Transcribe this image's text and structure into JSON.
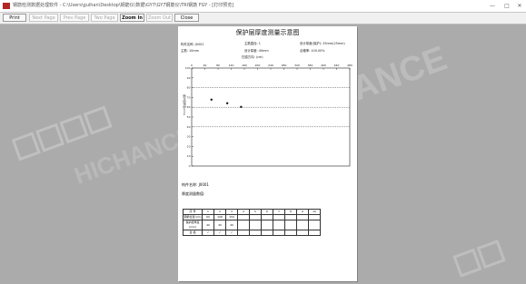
{
  "window": {
    "title": "钢筋检测数据处理软件 - C:\\Users\\guihan\\Desktop\\钢筋仪\\数据\\GY7\\GY7钢筋仪\\TRI钢筋 FGY - [打印预览]",
    "minimize_glyph": "—",
    "maximize_glyph": "□",
    "close_glyph": "✕"
  },
  "toolbar": {
    "print": "Print",
    "next_page": "Next Page",
    "prev_page": "Prev Page",
    "two_page": "Two Page",
    "zoom_in": "Zoom In",
    "zoom_out": "Zoom Out",
    "close": "Close"
  },
  "report": {
    "title": "保护层厚度测量示意图",
    "component_name_label": "构件名称: J0001",
    "stirrup_spacing_label": "主筋直径: 1",
    "design_thickness_label": "设计厚度(保护): 25mm(25mm)",
    "main_rebar_label": "主筋: 10mm",
    "design_value_label": "设计厚度: 40mm",
    "ratio_label": "合格率: 100.00%",
    "scan_direction_label": "扫描方向: (cm)",
    "component_name_bottom": "构件名称: J0001",
    "table_caption": "厚度测量数值:",
    "table_rows": [
      [
        "序 号",
        "1",
        "2",
        "3",
        "4",
        "5",
        "6",
        "7",
        "8",
        "9",
        "10"
      ],
      [
        "钢筋位置(cm)",
        "60",
        "108",
        "150",
        "",
        "",
        "",
        "",
        "",
        "",
        ""
      ],
      [
        "保护层厚度(mm)",
        "40",
        "40",
        "40",
        "",
        "",
        "",
        "",
        "",
        "",
        ""
      ],
      [
        "合 格",
        "√",
        "√",
        "√",
        "",
        "",
        "",
        "",
        "",
        "",
        ""
      ]
    ]
  },
  "chart_data": {
    "type": "scatter",
    "x_tick_labels": [
      "0",
      "40",
      "80",
      "120",
      "160",
      "200",
      "240",
      "280",
      "320",
      "360",
      "400",
      "440",
      "480"
    ],
    "y_tick_labels": [
      "100",
      "90",
      "80",
      "70",
      "60",
      "50",
      "40",
      "30",
      "20",
      "10",
      "0"
    ],
    "y_axis_label": "保护层厚度(mm)",
    "xlim": [
      0,
      480
    ],
    "ylim": [
      0,
      100
    ],
    "y_inverted": true,
    "reference_lines_y": [
      40,
      60,
      80
    ],
    "points": [
      {
        "x": 60,
        "y": 40
      },
      {
        "x": 108,
        "y": 40
      },
      {
        "x": 150,
        "y": 40
      }
    ]
  },
  "watermark": {
    "brand_cn": "海创高科",
    "brand_en": "HICHANCE"
  }
}
